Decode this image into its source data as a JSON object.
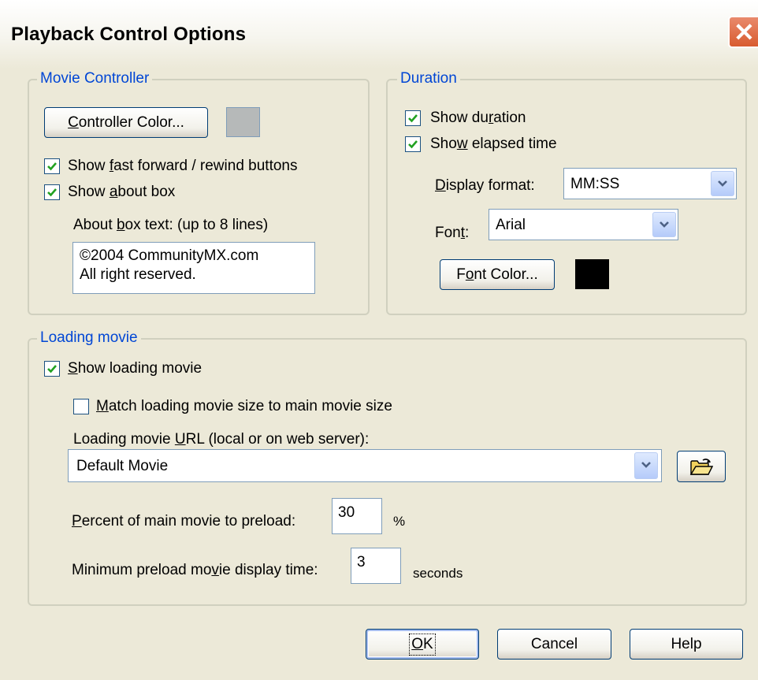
{
  "window": {
    "title": "Playback Control Options"
  },
  "movie_controller": {
    "legend": "Movie Controller",
    "controller_color_button": "Controller Color...",
    "controller_color": "#b6b9b9",
    "show_ff_rewind": {
      "label": "Show fast forward / rewind buttons",
      "checked": true
    },
    "show_about_box": {
      "label": "Show about box",
      "checked": true
    },
    "about_box_text_label": "About box text: (up to 8 lines)",
    "about_box_lines": [
      "©2004 CommunityMX.com",
      "All right reserved."
    ]
  },
  "duration": {
    "legend": "Duration",
    "show_duration": {
      "label": "Show duration",
      "checked": true
    },
    "show_elapsed": {
      "label": "Show elapsed time",
      "checked": true
    },
    "display_format_label": "Display format:",
    "display_format_value": "MM:SS",
    "font_label": "Font:",
    "font_value": "Arial",
    "font_color_button": "Font Color...",
    "font_color": "#000000"
  },
  "loading_movie": {
    "legend": "Loading movie",
    "show_loading_movie": {
      "label": "Show loading movie",
      "checked": true
    },
    "match_size": {
      "label": "Match loading movie size to main movie size",
      "checked": false
    },
    "url_label": "Loading movie URL (local or on web server):",
    "url_value": "Default Movie",
    "percent_label": "Percent of main movie to preload:",
    "percent_value": "30",
    "percent_unit": "%",
    "min_display_label": "Minimum preload movie display time:",
    "min_display_value": "3",
    "min_display_unit": "seconds"
  },
  "footer": {
    "ok": "OK",
    "cancel": "Cancel",
    "help": "Help"
  },
  "icons": {
    "close": "close-icon",
    "check": "check-icon",
    "dropdown": "chevron-down-icon",
    "browse": "open-folder-icon"
  }
}
